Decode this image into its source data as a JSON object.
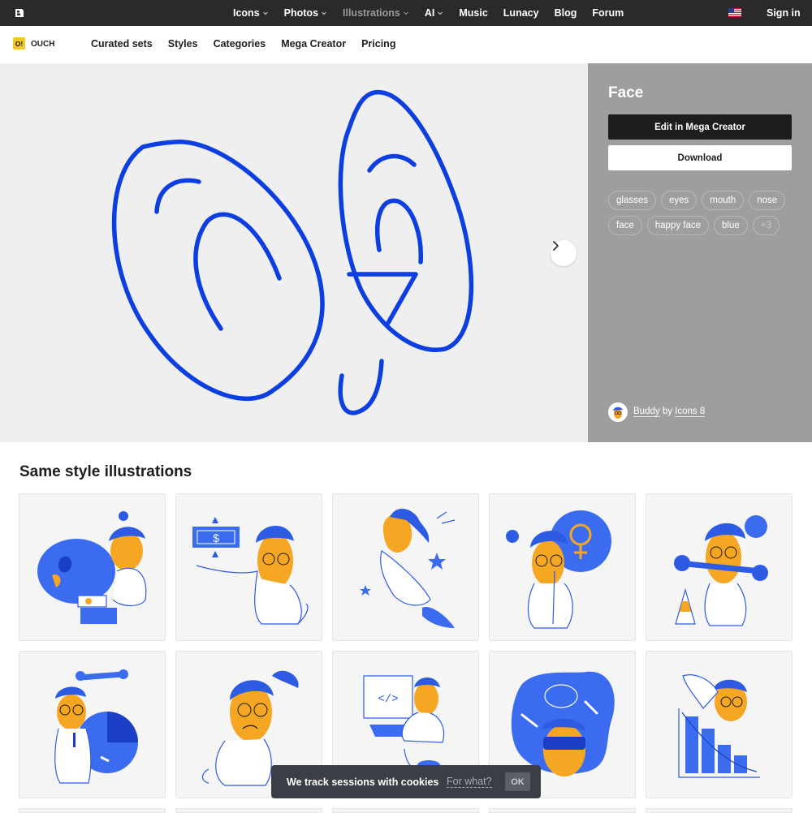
{
  "topnav": {
    "items": [
      {
        "label": "Icons",
        "caret": true
      },
      {
        "label": "Photos",
        "caret": true
      },
      {
        "label": "Illustrations",
        "caret": true,
        "active": true
      },
      {
        "label": "AI",
        "caret": true
      },
      {
        "label": "Music",
        "caret": false
      },
      {
        "label": "Lunacy",
        "caret": false
      },
      {
        "label": "Blog",
        "caret": false
      },
      {
        "label": "Forum",
        "caret": false
      }
    ],
    "sign_in": "Sign in",
    "flag_icon": "us-flag-icon"
  },
  "subnav": {
    "badge": "O!",
    "brand": "OUCH",
    "items": [
      "Curated sets",
      "Styles",
      "Categories",
      "Mega Creator",
      "Pricing"
    ]
  },
  "detail": {
    "title": "Face",
    "edit_button": "Edit in Mega Creator",
    "download_button": "Download",
    "tags": [
      "glasses",
      "eyes",
      "mouth",
      "nose",
      "face",
      "happy face",
      "blue"
    ],
    "more_tags": "+3",
    "author_name": "Buddy",
    "author_by": "by",
    "author_source": "Icons 8"
  },
  "colors": {
    "accent_blue": "#0d3fe0",
    "yellow": "#f5a623",
    "panel_gray": "#9e9e9e"
  },
  "same_style": {
    "title": "Same style illustrations",
    "cards": [
      {
        "icon": "painter-illustration-icon"
      },
      {
        "icon": "money-illustration-icon"
      },
      {
        "icon": "rocket-illustration-icon"
      },
      {
        "icon": "female-sign-illustration-icon"
      },
      {
        "icon": "repair-wrench-illustration-icon"
      },
      {
        "icon": "pie-chart-illustration-icon"
      },
      {
        "icon": "confused-person-illustration-icon"
      },
      {
        "icon": "programmer-illustration-icon"
      },
      {
        "icon": "virtual-reality-illustration-icon"
      },
      {
        "icon": "falling-chart-illustration-icon"
      }
    ]
  },
  "cookie": {
    "text": "We track sessions with cookies",
    "link": "For what?",
    "ok": "OK"
  }
}
